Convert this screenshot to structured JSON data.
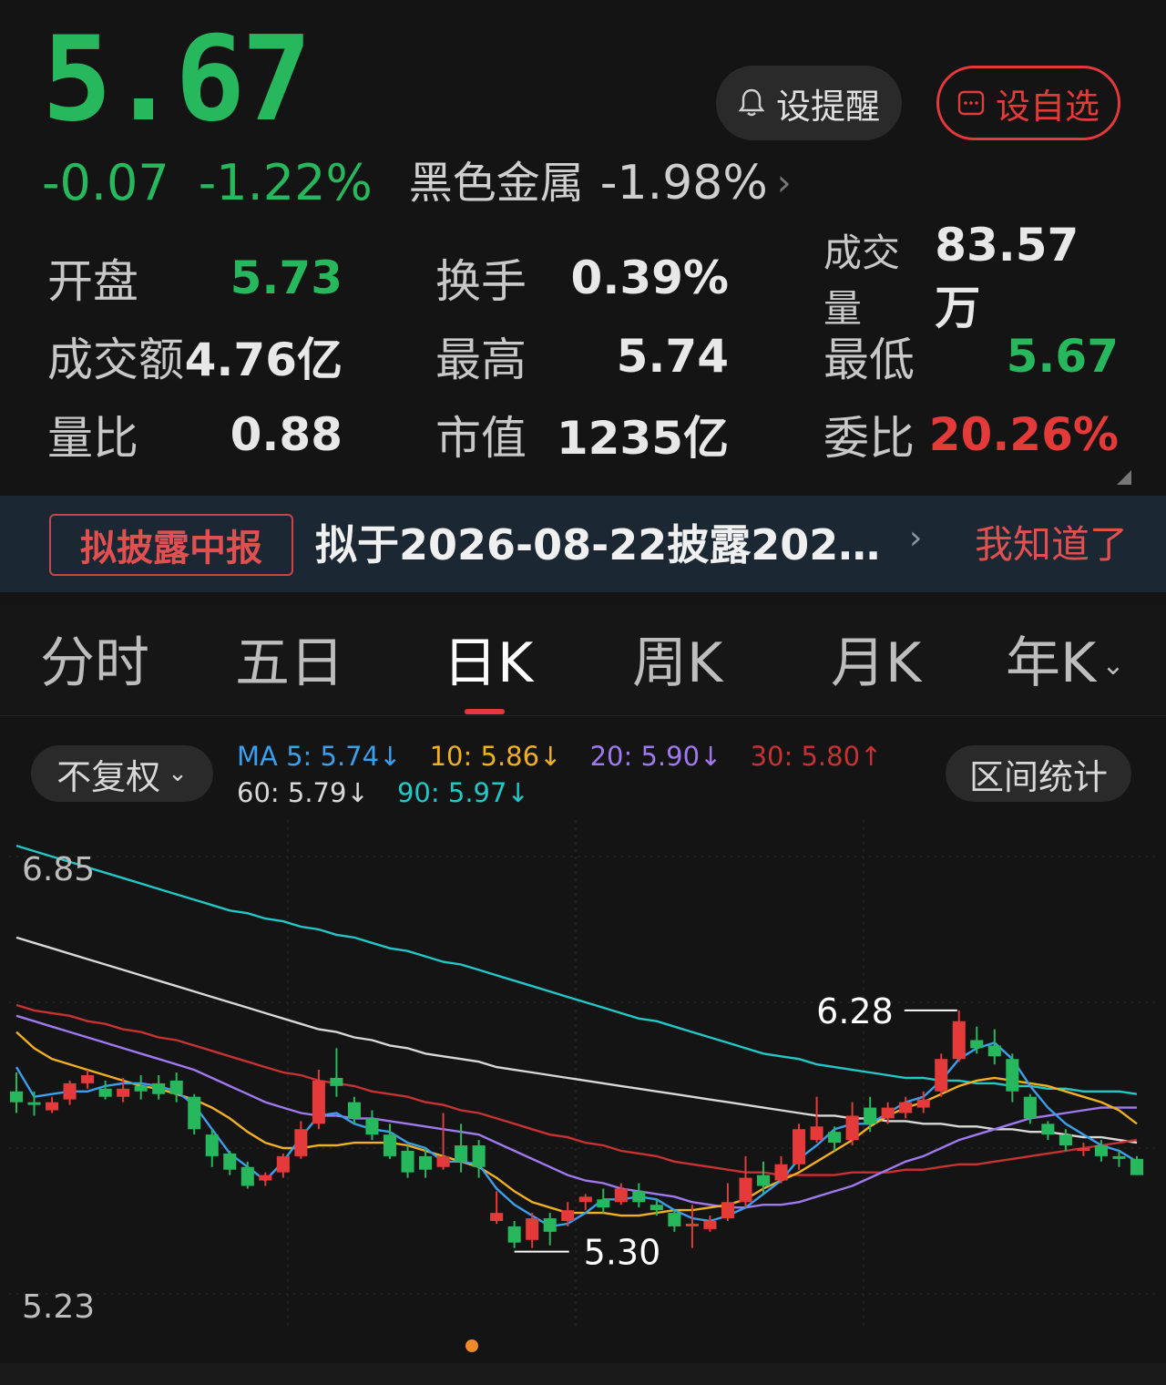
{
  "quote": {
    "price": "5.67",
    "change": "-0.07",
    "change_pct": "-1.22%",
    "sector_name": "黑色金属",
    "sector_pct": "-1.98%",
    "remind_label": "设提醒",
    "watch_label": "设自选"
  },
  "stats": {
    "open_label": "开盘",
    "open": "5.73",
    "turnover_label": "换手",
    "turnover": "0.39%",
    "volume_label": "成交量",
    "volume": "83.57万",
    "amount_label": "成交额",
    "amount": "4.76亿",
    "high_label": "最高",
    "high": "5.74",
    "low_label": "最低",
    "low": "5.67",
    "vol_ratio_label": "量比",
    "vol_ratio": "0.88",
    "mktcap_label": "市值",
    "mktcap": "1235亿",
    "bid_ratio_label": "委比",
    "bid_ratio": "20.26%"
  },
  "notice": {
    "tag": "拟披露中报",
    "text": "拟于2026-08-22披露2026…",
    "dismiss": "我知道了"
  },
  "tabs": [
    "分时",
    "五日",
    "日K",
    "周K",
    "月K",
    "年K"
  ],
  "active_tab": "日K",
  "chart_toolbar": {
    "adjust": "不复权",
    "range_stats": "区间统计",
    "ma5": "MA 5: 5.74↓",
    "ma10": "10: 5.86↓",
    "ma20": "20: 5.90↓",
    "ma30": "30: 5.80↑",
    "ma60": "60: 5.79↓",
    "ma90": "90: 5.97↓"
  },
  "colors": {
    "up": "#e53a3a",
    "down": "#27b75c",
    "ma5": "#3aa0ee",
    "ma10": "#f0b020",
    "ma20": "#a078f0",
    "ma30": "#c83232",
    "ma60": "#d8d8d8",
    "ma90": "#22c8c8"
  },
  "chart_data": {
    "type": "candlestick",
    "y_top_label": "6.85",
    "y_bottom_label": "5.23",
    "ylim": [
      5.23,
      6.85
    ],
    "high_marker": "6.28",
    "low_marker": "5.30",
    "candles": [
      [
        5.98,
        5.94,
        6.05,
        5.9
      ],
      [
        5.94,
        5.93,
        5.98,
        5.89
      ],
      [
        5.91,
        5.94,
        5.96,
        5.9
      ],
      [
        5.95,
        6.01,
        6.02,
        5.93
      ],
      [
        6.01,
        6.04,
        6.06,
        5.99
      ],
      [
        5.99,
        5.96,
        6.02,
        5.95
      ],
      [
        5.96,
        5.99,
        6.03,
        5.94
      ],
      [
        6.0,
        5.98,
        6.04,
        5.95
      ],
      [
        6.01,
        5.97,
        6.04,
        5.95
      ],
      [
        6.02,
        5.97,
        6.05,
        5.94
      ],
      [
        5.96,
        5.84,
        5.97,
        5.82
      ],
      [
        5.82,
        5.74,
        5.84,
        5.7
      ],
      [
        5.75,
        5.69,
        5.76,
        5.67
      ],
      [
        5.7,
        5.63,
        5.72,
        5.62
      ],
      [
        5.65,
        5.67,
        5.68,
        5.63
      ],
      [
        5.68,
        5.74,
        5.75,
        5.66
      ],
      [
        5.74,
        5.84,
        5.87,
        5.73
      ],
      [
        5.86,
        6.02,
        6.06,
        5.84
      ],
      [
        6.03,
        6.0,
        6.14,
        5.96
      ],
      [
        5.94,
        5.88,
        5.96,
        5.86
      ],
      [
        5.88,
        5.82,
        5.91,
        5.8
      ],
      [
        5.82,
        5.74,
        5.86,
        5.73
      ],
      [
        5.76,
        5.68,
        5.78,
        5.66
      ],
      [
        5.74,
        5.69,
        5.77,
        5.66
      ],
      [
        5.7,
        5.74,
        5.9,
        5.69
      ],
      [
        5.78,
        5.72,
        5.86,
        5.68
      ],
      [
        5.78,
        5.7,
        5.8,
        5.66
      ],
      [
        5.5,
        5.53,
        5.61,
        5.49
      ],
      [
        5.48,
        5.42,
        5.5,
        5.4
      ],
      [
        5.43,
        5.51,
        5.53,
        5.4
      ],
      [
        5.51,
        5.46,
        5.53,
        5.41
      ],
      [
        5.5,
        5.54,
        5.57,
        5.48
      ],
      [
        5.57,
        5.59,
        5.6,
        5.54
      ],
      [
        5.58,
        5.55,
        5.62,
        5.53
      ],
      [
        5.57,
        5.62,
        5.64,
        5.56
      ],
      [
        5.61,
        5.57,
        5.64,
        5.55
      ],
      [
        5.56,
        5.54,
        5.58,
        5.52
      ],
      [
        5.53,
        5.48,
        5.54,
        5.46
      ],
      [
        5.48,
        5.49,
        5.56,
        5.4
      ],
      [
        5.47,
        5.5,
        5.52,
        5.46
      ],
      [
        5.51,
        5.57,
        5.64,
        5.5
      ],
      [
        5.57,
        5.66,
        5.74,
        5.55
      ],
      [
        5.67,
        5.63,
        5.72,
        5.6
      ],
      [
        5.65,
        5.71,
        5.74,
        5.64
      ],
      [
        5.71,
        5.84,
        5.86,
        5.69
      ],
      [
        5.8,
        5.85,
        5.96,
        5.79
      ],
      [
        5.83,
        5.79,
        5.85,
        5.76
      ],
      [
        5.8,
        5.89,
        5.94,
        5.78
      ],
      [
        5.92,
        5.86,
        5.96,
        5.83
      ],
      [
        5.88,
        5.92,
        5.94,
        5.86
      ],
      [
        5.9,
        5.94,
        5.96,
        5.88
      ],
      [
        5.92,
        5.95,
        5.98,
        5.9
      ],
      [
        5.98,
        6.1,
        6.12,
        5.96
      ],
      [
        6.1,
        6.24,
        6.28,
        6.09
      ],
      [
        6.17,
        6.14,
        6.22,
        6.12
      ],
      [
        6.15,
        6.11,
        6.21,
        6.08
      ],
      [
        6.1,
        5.98,
        6.12,
        5.94
      ],
      [
        5.96,
        5.88,
        5.97,
        5.86
      ],
      [
        5.86,
        5.82,
        5.87,
        5.8
      ],
      [
        5.82,
        5.78,
        5.84,
        5.76
      ],
      [
        5.76,
        5.77,
        5.79,
        5.74
      ],
      [
        5.78,
        5.74,
        5.8,
        5.72
      ],
      [
        5.74,
        5.73,
        5.76,
        5.7
      ],
      [
        5.73,
        5.67,
        5.74,
        5.67
      ]
    ],
    "ma5": [
      6.07,
      5.96,
      5.97,
      5.98,
      5.98,
      6.0,
      6.01,
      6.01,
      6.0,
      5.98,
      5.93,
      5.84,
      5.75,
      5.7,
      5.65,
      5.72,
      5.81,
      5.89,
      5.9,
      5.86,
      5.84,
      5.83,
      5.79,
      5.77,
      5.72,
      5.72,
      5.71,
      5.62,
      5.56,
      5.52,
      5.48,
      5.49,
      5.53,
      5.58,
      5.58,
      5.59,
      5.58,
      5.54,
      5.51,
      5.5,
      5.52,
      5.55,
      5.6,
      5.65,
      5.73,
      5.78,
      5.84,
      5.86,
      5.86,
      5.9,
      5.94,
      5.96,
      6.02,
      6.1,
      6.14,
      6.16,
      6.1,
      6.0,
      5.92,
      5.86,
      5.82,
      5.78,
      5.76,
      5.72
    ],
    "ma10": [
      6.2,
      6.14,
      6.1,
      6.08,
      6.06,
      6.04,
      6.02,
      6.0,
      5.99,
      5.97,
      5.95,
      5.92,
      5.88,
      5.83,
      5.79,
      5.77,
      5.77,
      5.78,
      5.78,
      5.79,
      5.79,
      5.79,
      5.78,
      5.76,
      5.74,
      5.72,
      5.7,
      5.66,
      5.61,
      5.57,
      5.55,
      5.53,
      5.53,
      5.53,
      5.52,
      5.52,
      5.53,
      5.54,
      5.54,
      5.55,
      5.56,
      5.58,
      5.62,
      5.65,
      5.68,
      5.72,
      5.76,
      5.8,
      5.85,
      5.89,
      5.92,
      5.94,
      5.97,
      6.0,
      6.02,
      6.03,
      6.02,
      6.01,
      6.0,
      5.98,
      5.96,
      5.94,
      5.91,
      5.86
    ],
    "ma20": [
      6.26,
      6.24,
      6.22,
      6.2,
      6.18,
      6.16,
      6.14,
      6.12,
      6.1,
      6.08,
      6.06,
      6.03,
      6.0,
      5.97,
      5.94,
      5.92,
      5.9,
      5.89,
      5.89,
      5.88,
      5.88,
      5.87,
      5.86,
      5.85,
      5.84,
      5.83,
      5.82,
      5.79,
      5.76,
      5.73,
      5.7,
      5.67,
      5.65,
      5.64,
      5.62,
      5.61,
      5.6,
      5.59,
      5.57,
      5.56,
      5.55,
      5.55,
      5.56,
      5.56,
      5.57,
      5.59,
      5.61,
      5.63,
      5.66,
      5.69,
      5.72,
      5.74,
      5.77,
      5.8,
      5.82,
      5.84,
      5.86,
      5.88,
      5.89,
      5.9,
      5.91,
      5.92,
      5.92,
      5.92
    ],
    "ma30": [
      6.3,
      6.28,
      6.27,
      6.26,
      6.24,
      6.23,
      6.21,
      6.2,
      6.18,
      6.17,
      6.15,
      6.13,
      6.11,
      6.09,
      6.07,
      6.05,
      6.04,
      6.02,
      6.01,
      6.0,
      5.98,
      5.97,
      5.96,
      5.94,
      5.93,
      5.91,
      5.9,
      5.88,
      5.86,
      5.84,
      5.82,
      5.81,
      5.79,
      5.78,
      5.76,
      5.75,
      5.74,
      5.72,
      5.71,
      5.7,
      5.69,
      5.68,
      5.68,
      5.67,
      5.67,
      5.67,
      5.67,
      5.68,
      5.68,
      5.68,
      5.69,
      5.69,
      5.7,
      5.71,
      5.71,
      5.72,
      5.73,
      5.74,
      5.75,
      5.76,
      5.77,
      5.78,
      5.79,
      5.8
    ],
    "ma60": [
      6.55,
      6.53,
      6.51,
      6.49,
      6.47,
      6.45,
      6.43,
      6.41,
      6.39,
      6.37,
      6.35,
      6.33,
      6.31,
      6.29,
      6.27,
      6.25,
      6.23,
      6.21,
      6.2,
      6.18,
      6.17,
      6.15,
      6.14,
      6.12,
      6.11,
      6.1,
      6.09,
      6.07,
      6.06,
      6.05,
      6.04,
      6.03,
      6.02,
      6.01,
      6.0,
      5.99,
      5.98,
      5.97,
      5.96,
      5.95,
      5.94,
      5.93,
      5.92,
      5.91,
      5.9,
      5.89,
      5.89,
      5.88,
      5.88,
      5.87,
      5.87,
      5.86,
      5.86,
      5.85,
      5.85,
      5.84,
      5.84,
      5.83,
      5.83,
      5.82,
      5.81,
      5.81,
      5.8,
      5.79
    ],
    "ma90": [
      6.89,
      6.87,
      6.85,
      6.83,
      6.81,
      6.79,
      6.77,
      6.75,
      6.73,
      6.71,
      6.69,
      6.67,
      6.65,
      6.64,
      6.62,
      6.61,
      6.59,
      6.58,
      6.56,
      6.55,
      6.53,
      6.51,
      6.5,
      6.48,
      6.46,
      6.45,
      6.43,
      6.41,
      6.39,
      6.37,
      6.35,
      6.33,
      6.31,
      6.29,
      6.27,
      6.25,
      6.24,
      6.22,
      6.2,
      6.18,
      6.16,
      6.14,
      6.12,
      6.11,
      6.1,
      6.08,
      6.07,
      6.06,
      6.05,
      6.04,
      6.03,
      6.03,
      6.02,
      6.02,
      6.01,
      6.01,
      6.0,
      6.0,
      5.99,
      5.99,
      5.98,
      5.98,
      5.98,
      5.97
    ]
  }
}
